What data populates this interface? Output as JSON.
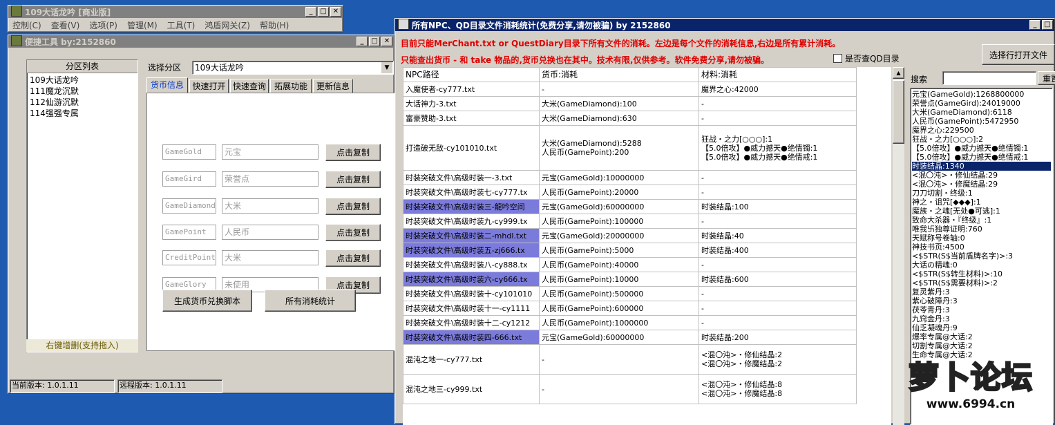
{
  "main_window": {
    "title": "109大话龙吟 [商业版]",
    "menu": [
      "控制(C)",
      "查看(V)",
      "选项(P)",
      "管理(M)",
      "工具(T)",
      "鸿盾网关(Z)",
      "帮助(H)"
    ]
  },
  "tool_window": {
    "title": "便捷工具  by:2152860",
    "partition_list_header": "分区列表",
    "partitions": [
      "109大话龙吟",
      "111魔龙沉默",
      "112仙游沉默",
      "114强强专属"
    ],
    "partition_footer": "右键增删(支持拖入)",
    "select_label": "选择分区",
    "select_value": "109大话龙吟",
    "tabs": [
      "货币信息",
      "快速打开",
      "快速查询",
      "拓展功能",
      "更新信息"
    ],
    "currency_rows": [
      {
        "code": "GameGold",
        "name": "元宝",
        "button": "点击复制"
      },
      {
        "code": "GameGird",
        "name": "荣誉点",
        "button": "点击复制"
      },
      {
        "code": "GameDiamond",
        "name": "大米",
        "button": "点击复制"
      },
      {
        "code": "GamePoint",
        "name": "人民币",
        "button": "点击复制"
      },
      {
        "code": "CreditPoint",
        "name": "大米",
        "button": "点击复制"
      },
      {
        "code": "GameGlory",
        "name": "未使用",
        "button": "点击复制"
      }
    ],
    "generate_button": "生成货币兑换脚本",
    "stats_button": "所有消耗统计",
    "status_current": "当前版本: 1.0.1.11",
    "status_remote": "远程版本: 1.0.1.11"
  },
  "stats_window": {
    "title": "所有NPC、QD目录文件消耗统计(免费分享,请勿被骗)      by 2152860",
    "notice_line1": "目前只能MerChant.txt or QuestDiary目录下所有文件的消耗。左边是每个文件的消耗信息,右边是所有累计消耗。",
    "notice_line2": "只能查出货币 - 和 take 物品的,货币兑换也在其中。技术有限,仅供参考。软件免费分享,请勿被骗。",
    "checkbox_label": "是否查QD目录",
    "open_file_button": "选择行打开文件",
    "search_label": "搜索",
    "reset_button": "重置",
    "columns": [
      "NPC路径",
      "货币:消耗",
      "材料:消耗"
    ],
    "rows": [
      {
        "path": "入魔使者-cy777.txt",
        "currency": [
          "-"
        ],
        "material": [
          "魔界之心:42000"
        ],
        "hl": false
      },
      {
        "path": "大话神力-3.txt",
        "currency": [
          "大米(GameDiamond):100"
        ],
        "material": [
          "-"
        ],
        "hl": false
      },
      {
        "path": "富豪赞助-3.txt",
        "currency": [
          "大米(GameDiamond):630"
        ],
        "material": [
          "-"
        ],
        "hl": false
      },
      {
        "path": "打造破无敌-cy101010.txt",
        "currency": [
          "大米(GameDiamond):5288",
          "人民币(GamePoint):200"
        ],
        "material": [
          "狂战・之力[○○○]:1",
          "【5.0倍攻】●威力撼天●绝情镯:1",
          "【5.0倍攻】●威力撼天●绝情戒:1"
        ],
        "hl": false
      },
      {
        "path": "时装突破文件\\高级时装一-3.txt",
        "currency": [
          "元宝(GameGold):10000000"
        ],
        "material": [
          "-"
        ],
        "hl": false
      },
      {
        "path": "时装突破文件\\高级时装七-cy777.tx",
        "currency": [
          "人民币(GamePoint):20000"
        ],
        "material": [
          "-"
        ],
        "hl": false
      },
      {
        "path": "时装突破文件\\高级时装三-龍吟空间",
        "currency": [
          "元宝(GameGold):60000000"
        ],
        "material": [
          "时装结晶:100"
        ],
        "hl": true
      },
      {
        "path": "时装突破文件\\高级时装九-cy999.tx",
        "currency": [
          "人民币(GamePoint):100000"
        ],
        "material": [
          "-"
        ],
        "hl": false
      },
      {
        "path": "时装突破文件\\高级时装二-mhdl.txt",
        "currency": [
          "元宝(GameGold):20000000"
        ],
        "material": [
          "时装结晶:40"
        ],
        "hl": true
      },
      {
        "path": "时装突破文件\\高级时装五-zj666.tx",
        "currency": [
          "人民币(GamePoint):5000"
        ],
        "material": [
          "时装结晶:400"
        ],
        "hl": true
      },
      {
        "path": "时装突破文件\\高级时装八-cy888.tx",
        "currency": [
          "人民币(GamePoint):40000"
        ],
        "material": [
          "-"
        ],
        "hl": false
      },
      {
        "path": "时装突破文件\\高级时装六-cy666.tx",
        "currency": [
          "人民币(GamePoint):10000"
        ],
        "material": [
          "时装结晶:600"
        ],
        "hl": true
      },
      {
        "path": "时装突破文件\\高级时装十-cy101010",
        "currency": [
          "人民币(GamePoint):500000"
        ],
        "material": [
          "-"
        ],
        "hl": false
      },
      {
        "path": "时装突破文件\\高级时装十一-cy1111",
        "currency": [
          "人民币(GamePoint):600000"
        ],
        "material": [
          "-"
        ],
        "hl": false
      },
      {
        "path": "时装突破文件\\高级时装十二-cy1212",
        "currency": [
          "人民币(GamePoint):1000000"
        ],
        "material": [
          "-"
        ],
        "hl": false
      },
      {
        "path": "时装突破文件\\高级时装四-666.txt",
        "currency": [
          "元宝(GameGold):60000000"
        ],
        "material": [
          "时装结晶:200"
        ],
        "hl": true
      },
      {
        "path": "混沌之地一-cy777.txt",
        "currency": [
          "-"
        ],
        "material": [
          "<混〇沌>・修仙结晶:2",
          "<混〇沌>・修魔结晶:2"
        ],
        "hl": false
      },
      {
        "path": "混沌之地三-cy999.txt",
        "currency": [
          "-"
        ],
        "material": [
          "<混〇沌>・修仙结晶:8",
          "<混〇沌>・修魔结晶:8"
        ],
        "hl": false
      }
    ],
    "totals": [
      "元宝(GameGold):1268800000",
      "荣誉点(GameGird):24019000",
      "大米(GameDiamond):6118",
      "人民币(GamePoint):5472950",
      "魔界之心:229500",
      "狂战・之力[○○○]:2",
      "【5.0倍攻】●威力撼天●绝情镯:1",
      "【5.0倍攻】●威力撼天●绝情戒:1",
      "时装结晶:1340",
      "<混〇沌>・修仙结晶:29",
      "<混〇沌>・修魔结晶:29",
      "刀刀切割・终级:1",
      "神之・诅咒[◆◆◆]:1",
      "魔族・之魂[无处●可逃]:1",
      "致命大杀器・『终级』:1",
      "唯我卐独尊证明:760",
      "天赋称号卷轴:0",
      "神技书页:4500",
      "<$STR(S$当前盾牌名字)>:3",
      "大话の精魂:0",
      "<$STR(S$转生材料)>:10",
      "<$STR(S$需要材料)>:2",
      "复灵紫丹:3",
      "紫心破障丹:3",
      "茯苓青丹:3",
      "九窍金丹:3",
      "仙乏凝魂丹:9",
      "爆率专属@大话:2",
      "切割专属@大话:2",
      "生命专属@大话:2"
    ],
    "selected_total_index": 8
  },
  "watermark": {
    "logo_text": "萝卜论坛",
    "url": "www.6994.cn"
  }
}
